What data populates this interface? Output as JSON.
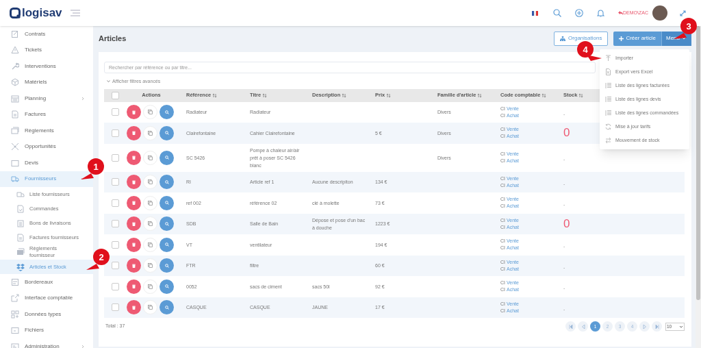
{
  "header": {
    "logo": "logisav",
    "user": "DEMO\\ZAC"
  },
  "sidebar": {
    "items": [
      {
        "label": "Contrats",
        "selected": false,
        "expandable": false
      },
      {
        "label": "Tickets",
        "selected": false,
        "expandable": false
      },
      {
        "label": "Interventions",
        "selected": false,
        "expandable": false
      },
      {
        "label": "Matériels",
        "selected": false,
        "expandable": false
      },
      {
        "label": "Planning",
        "selected": false,
        "expandable": true,
        "expanded": false
      },
      {
        "label": "Factures",
        "selected": false,
        "expandable": false
      },
      {
        "label": "Règlements",
        "selected": false,
        "expandable": false
      },
      {
        "label": "Opportunités",
        "selected": false,
        "expandable": false
      },
      {
        "label": "Devis",
        "selected": false,
        "expandable": false
      },
      {
        "label": "Fournisseurs",
        "selected": true,
        "expandable": true,
        "expanded": true,
        "children": [
          {
            "label": "Liste fournisseurs",
            "selected": false
          },
          {
            "label": "Commandes",
            "selected": false
          },
          {
            "label": "Bons de livraisons",
            "selected": false
          },
          {
            "label": "Factures fournisseurs",
            "selected": false
          },
          {
            "label": "Règlements fournisseur",
            "selected": false
          },
          {
            "label": "Articles et Stock",
            "selected": true
          }
        ]
      },
      {
        "label": "Bordereaux",
        "selected": false,
        "expandable": false
      },
      {
        "label": "Interface comptable",
        "selected": false,
        "expandable": false
      },
      {
        "label": "Données types",
        "selected": false,
        "expandable": false
      },
      {
        "label": "Fichiers",
        "selected": false,
        "expandable": false
      },
      {
        "label": "Administration",
        "selected": false,
        "expandable": true,
        "expanded": false
      }
    ]
  },
  "page": {
    "title": "Articles",
    "organisations_button": "Organisations",
    "create_button": "Créer article",
    "menu_button": "Menu"
  },
  "menu": {
    "expanded": true,
    "items": [
      {
        "label": "Importer"
      },
      {
        "label": "Export vers Excel"
      },
      {
        "label": "Liste des lignes facturées"
      },
      {
        "label": "Liste des lignes devis"
      },
      {
        "label": "Liste des lignes commandées"
      },
      {
        "label": "Mise à jour tarifs"
      },
      {
        "label": "Mouvement de stock"
      }
    ]
  },
  "search": {
    "placeholder": "Rechercher par référence ou par titre..."
  },
  "filters_toggle": "Afficher filtres avancés",
  "table": {
    "all_checked": false,
    "columns": [
      {
        "label": "Actions",
        "sortable": false
      },
      {
        "label": "Référence",
        "sortable": true
      },
      {
        "label": "Titre",
        "sortable": true
      },
      {
        "label": "Description",
        "sortable": true
      },
      {
        "label": "Prix",
        "sortable": true
      },
      {
        "label": "Famille d'article",
        "sortable": true
      },
      {
        "label": "Code comptable",
        "sortable": true
      },
      {
        "label": "Stock",
        "sortable": true
      }
    ],
    "rows": [
      {
        "checked": false,
        "reference": "Radiateur",
        "title": "Radiateur",
        "family": "Divers",
        "codes": [
          {
            "code": "CI",
            "label": "Vente"
          },
          {
            "code": "CI",
            "label": "Achat"
          }
        ],
        "stock": "-",
        "stock_alert": false
      },
      {
        "checked": false,
        "reference": "Clairefontaine",
        "title": "Cahier Clairefontaine",
        "price": "5 €",
        "family": "Divers",
        "codes": [
          {
            "code": "CI",
            "label": "Vente"
          },
          {
            "code": "CI",
            "label": "Achat"
          }
        ],
        "stock": "0",
        "stock_alert": true
      },
      {
        "checked": false,
        "reference": "SC 5426",
        "title": "Pompe à chaleur air/air prêt à poser SC 5426 blanc",
        "family": "Divers",
        "codes": [
          {
            "code": "CI",
            "label": "Vente"
          },
          {
            "code": "CI",
            "label": "Achat"
          }
        ],
        "stock": "-",
        "stock_alert": false
      },
      {
        "checked": false,
        "reference": "RI",
        "title": "Article ref 1",
        "description": "Aucune descripiton",
        "price": "134 €",
        "codes": [
          {
            "code": "CI",
            "label": "Vente"
          },
          {
            "code": "CI",
            "label": "Achat"
          }
        ],
        "stock": "-",
        "stock_alert": false
      },
      {
        "checked": false,
        "reference": "ref 002",
        "title": "référence 02",
        "description": "clé à molette",
        "price": "73 €",
        "codes": [
          {
            "code": "CI",
            "label": "Vente"
          },
          {
            "code": "CI",
            "label": "Achat"
          }
        ],
        "stock": "-",
        "stock_alert": false
      },
      {
        "checked": false,
        "reference": "SDB",
        "title": "Salle de Bain",
        "description": "Dépose et pose d'un bac à douche",
        "price": "1223 €",
        "codes": [
          {
            "code": "CI",
            "label": "Vente"
          },
          {
            "code": "CI",
            "label": "Achat"
          }
        ],
        "stock": "0",
        "stock_alert": true
      },
      {
        "checked": false,
        "reference": "VT",
        "title": "ventilateur",
        "price": "194 €",
        "codes": [
          {
            "code": "CI",
            "label": "Vente"
          },
          {
            "code": "CI",
            "label": "Achat"
          }
        ],
        "stock": "-",
        "stock_alert": false
      },
      {
        "checked": false,
        "reference": "FTR",
        "title": "filtre",
        "price": "60 €",
        "codes": [
          {
            "code": "CI",
            "label": "Vente"
          },
          {
            "code": "CI",
            "label": "Achat"
          }
        ],
        "stock": "-",
        "stock_alert": false
      },
      {
        "checked": false,
        "reference": "0052",
        "title": "sacs de ciment",
        "description": "sacs 50l",
        "price": "92 €",
        "codes": [
          {
            "code": "CI",
            "label": "Vente"
          },
          {
            "code": "CI",
            "label": "Achat"
          }
        ],
        "stock": "-",
        "stock_alert": false
      },
      {
        "checked": false,
        "reference": "CASQUE",
        "title": "CASQUE",
        "description": "JAUNE",
        "price": "17 €",
        "codes": [
          {
            "code": "CI",
            "label": "Vente"
          },
          {
            "code": "CI",
            "label": "Achat"
          }
        ],
        "stock": "-",
        "stock_alert": false
      }
    ]
  },
  "total": "Total : 37",
  "pagination": {
    "pages": [
      {
        "label": "1",
        "selected": true
      },
      {
        "label": "2",
        "selected": false
      },
      {
        "label": "3",
        "selected": false
      },
      {
        "label": "4",
        "selected": false
      }
    ],
    "page_size": "10"
  },
  "annotations": [
    {
      "label": "1"
    },
    {
      "label": "2"
    },
    {
      "label": "3"
    },
    {
      "label": "4"
    }
  ]
}
